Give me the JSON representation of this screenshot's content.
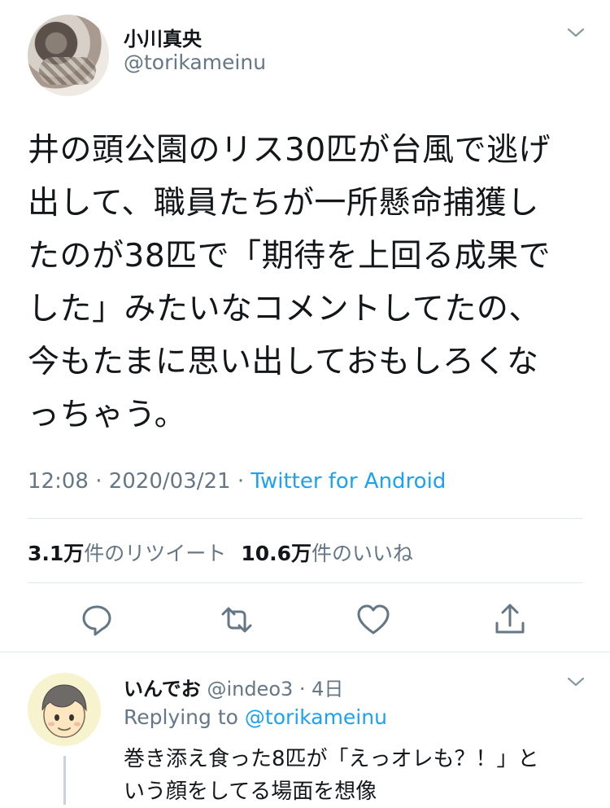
{
  "main_tweet": {
    "display_name": "小川真央",
    "handle": "@torikameinu",
    "text_lines": [
      "井の頭公園のリス30匹が台風で逃げ",
      "出して、職員たちが一所懸命捕獲し",
      "たのが38匹で「期待を上回る成果で",
      "した」みたいなコメントしてたの、",
      "今もたまに思い出しておもしろくな",
      "っちゃう。"
    ],
    "timestamp": "12:08 · 2020/03/21 · ",
    "source": "Twitter for Android",
    "retweets_count": "3.1万",
    "retweets_label": "件のリツイート",
    "likes_count": "10.6万",
    "likes_label": "件のいいね"
  },
  "actions": [
    {
      "icon": "reply-icon"
    },
    {
      "icon": "retweet-icon"
    },
    {
      "icon": "like-icon"
    },
    {
      "icon": "share-icon"
    }
  ],
  "reply": {
    "display_name": "いんでお",
    "handle_time": " @indeo3 · 4日",
    "replying_prefix": "Replying to ",
    "replying_to": "@torikameinu",
    "text_lines": [
      "巻き添え食った8匹が「えっオレも？！」と",
      "いう顔をしてる場面を想像"
    ]
  },
  "colors": {
    "text": "#14171a",
    "secondary": "#657786",
    "accent": "#1da1f2",
    "divider": "#e1e8ed"
  }
}
